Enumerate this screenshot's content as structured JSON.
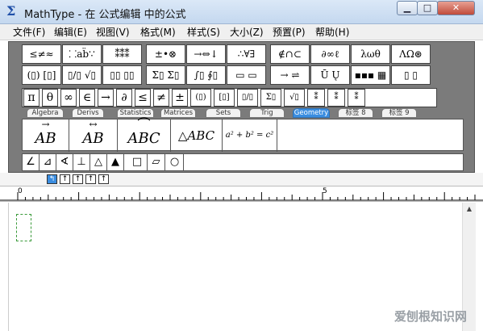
{
  "window": {
    "title": "MathType - 在 公式编辑 中的公式",
    "app_icon": "Σ",
    "minimize": "▁",
    "maximize": "□",
    "close": "✕"
  },
  "menu": [
    "文件(F)",
    "编辑(E)",
    "视图(V)",
    "格式(M)",
    "样式(S)",
    "大小(Z)",
    "预置(P)",
    "帮助(H)"
  ],
  "palette_row1": [
    "≤≠≈",
    "⸬ab̈∵",
    "⁑⁑⁑",
    "±•⊗",
    "→⇔↓",
    "∴∀∃",
    "∉∩⊂",
    "∂∞ℓ",
    "λωθ",
    "ΛΩ⊛"
  ],
  "palette_row2": [
    "(▯) [▯]",
    "▯/▯ √▯",
    "▯▯ ▯▯",
    "Σ▯ Σ▯",
    "∫▯ ∮▯",
    "▭ ▭",
    "→ ⇌",
    "Ū Ų",
    "▪▪▪ ▦",
    "▯ ▯"
  ],
  "symbols": [
    "π",
    "θ",
    "∞",
    "∈",
    "→",
    "∂",
    "≤",
    "≠",
    "±",
    "(▯)",
    "[▯]",
    "▯/▯",
    "Σ▯",
    "√▯",
    "⁑",
    "⁑",
    "⁑"
  ],
  "tabs": [
    "Algebra",
    "Derivs",
    "Statistics",
    "Matrices",
    "Sets",
    "Trig",
    "Geometry",
    "标签 8",
    "标签 9"
  ],
  "active_tab": "Geometry",
  "templates": [
    {
      "text": "AB",
      "overline": "→"
    },
    {
      "text": "AB",
      "overline": "↔"
    },
    {
      "text": "ABC",
      "overline": "⌒"
    },
    {
      "text": "△ABC"
    },
    {
      "text": "a² + b² = c²"
    }
  ],
  "geometry_symbols": [
    "∠",
    "⊿",
    "∢",
    "⊥",
    "△",
    "▲",
    "□",
    "▱",
    "○"
  ],
  "nav_buttons": [
    "↰",
    "↑",
    "↑",
    "↑",
    "↑"
  ],
  "ruler": {
    "labels": [
      "0",
      "5"
    ]
  },
  "scroll_up": "▲",
  "watermark": "爱刨根知识网"
}
